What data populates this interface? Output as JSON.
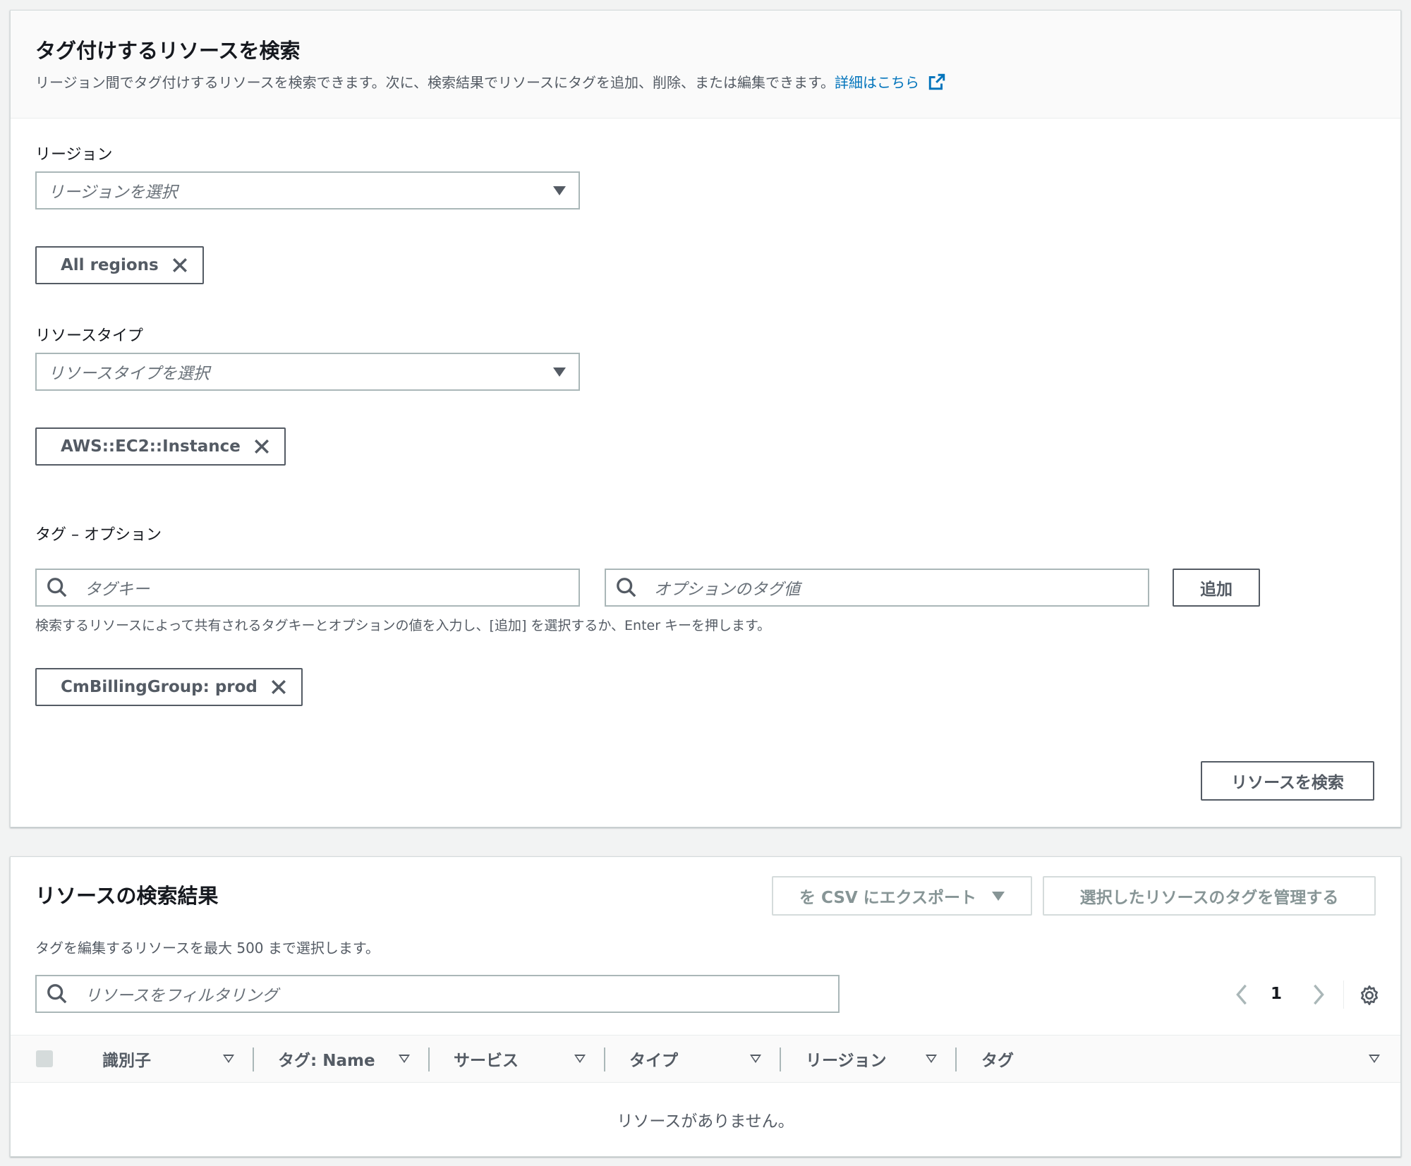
{
  "search_panel": {
    "title": "タグ付けするリソースを検索",
    "description": "リージョン間でタグ付けするリソースを検索できます。次に、検索結果でリソースにタグを追加、削除、または編集できます。",
    "learn_more_link": "詳細はこちら",
    "region": {
      "label": "リージョン",
      "placeholder": "リージョンを選択",
      "token": "All regions"
    },
    "resource_type": {
      "label": "リソースタイプ",
      "placeholder": "リソースタイプを選択",
      "token": "AWS::EC2::Instance"
    },
    "tags": {
      "label": "タグ – オプション",
      "key_placeholder": "タグキー",
      "value_placeholder": "オプションのタグ値",
      "add_button": "追加",
      "hint": "検索するリソースによって共有されるタグキーとオプションの値を入力し、[追加] を選択するか、Enter キーを押します。",
      "token": "CmBillingGroup: prod"
    },
    "search_button": "リソースを検索"
  },
  "results_panel": {
    "title": "リソースの検索結果",
    "export_button": "を CSV にエクスポート",
    "manage_tags_button": "選択したリソースのタグを管理する",
    "description": "タグを編集するリソースを最大 500 まで選択します。",
    "filter_placeholder": "リソースをフィルタリング",
    "page_number": "1",
    "columns": [
      "識別子",
      "タグ: Name",
      "サービス",
      "タイプ",
      "リージョン",
      "タグ"
    ],
    "empty_message": "リソースがありません。"
  },
  "colors": {
    "link": "#0073bb",
    "border": "#aab7b8",
    "text": "#16191f",
    "secondary_text": "#545b64"
  }
}
